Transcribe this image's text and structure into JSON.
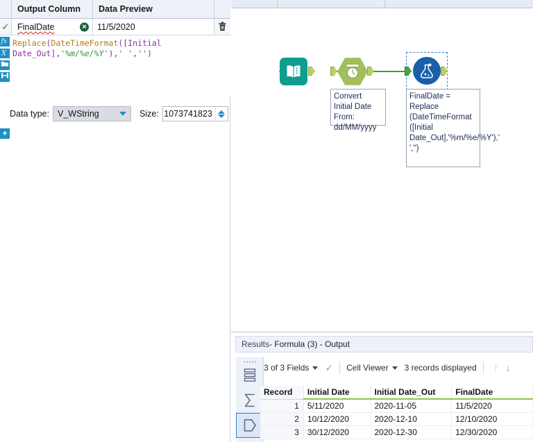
{
  "config_panel": {
    "grid": {
      "headers": [
        "",
        "Output Column",
        "Data Preview",
        ""
      ],
      "row": {
        "check": "✓",
        "field_name": "FinalDate",
        "clear_label": "✕",
        "data_preview": "11/5/2020",
        "delete_icon": "🗑"
      }
    },
    "tool_icons": [
      "fx-icon",
      "x-function-icon",
      "open-folder-icon",
      "save-disk-icon"
    ],
    "add_button_label": "+",
    "formula": {
      "full_text": "Replace(DateTimeFormat([Initial Date_Out],'%m/%e/%Y'),' ','')",
      "tokens": [
        {
          "t": "Replace",
          "c": "fn"
        },
        {
          "t": "(",
          "c": "paren"
        },
        {
          "t": "DateTimeFormat",
          "c": "fn"
        },
        {
          "t": "(",
          "c": "paren"
        },
        {
          "t": "[Initial Date_Out]",
          "c": "field"
        },
        {
          "t": ",",
          "c": "punct"
        },
        {
          "t": "'%m/%e/%Y'",
          "c": "str"
        },
        {
          "t": ")",
          "c": "paren"
        },
        {
          "t": ",",
          "c": "punct"
        },
        {
          "t": "' '",
          "c": "str"
        },
        {
          "t": ",",
          "c": "punct"
        },
        {
          "t": "''",
          "c": "str"
        },
        {
          "t": ")",
          "c": "paren"
        }
      ]
    },
    "data_type_label": "Data type:",
    "data_type_value": "V_WString",
    "size_label": "Size:",
    "size_value": "1073741823"
  },
  "canvas": {
    "nodes": [
      {
        "name": "input-data-node",
        "icon": "book-icon"
      },
      {
        "name": "datetime-node",
        "icon": "clock-hexagon-icon"
      },
      {
        "name": "formula-node",
        "icon": "flask-icon",
        "selected": true
      }
    ],
    "annotations": [
      {
        "name": "datetime-annotation",
        "text": "Convert Initial Date From: dd/MM/yyyy"
      },
      {
        "name": "formula-annotation",
        "text": "FinalDate = Replace (DateTimeFormat ([Initial Date_Out],'%m/%e/%Y'),' ','')"
      }
    ]
  },
  "results": {
    "title_prefix": "Results",
    "title_rest": " - Formula (3) - Output",
    "toolbar": {
      "fields_label": "3 of 3 Fields",
      "check_icon": "✓",
      "cell_viewer_label": "Cell Viewer",
      "records_label": "3 records displayed",
      "up_arrow": "↑",
      "down_arrow": "↓"
    },
    "sidebar_icons": [
      "table-rows-icon",
      "sigma-icon",
      "pentagon-shape-icon"
    ],
    "table": {
      "columns": [
        "Record",
        "Initial Date",
        "Initial Date_Out",
        "FinalDate"
      ],
      "rows": [
        [
          "1",
          "5/11/2020",
          "2020-11-05",
          "11/5/2020"
        ],
        [
          "2",
          "10/12/2020",
          "2020-12-10",
          "12/10/2020"
        ],
        [
          "3",
          "30/12/2020",
          "2020-12-30",
          "12/30/2020"
        ]
      ]
    }
  },
  "colors": {
    "accent_blue": "#1f8fc4",
    "node_teal": "#0f9e8e",
    "node_olive": "#a3bf5c",
    "node_blue": "#1a5fa8",
    "header_underline_green": "#8cc63f"
  }
}
